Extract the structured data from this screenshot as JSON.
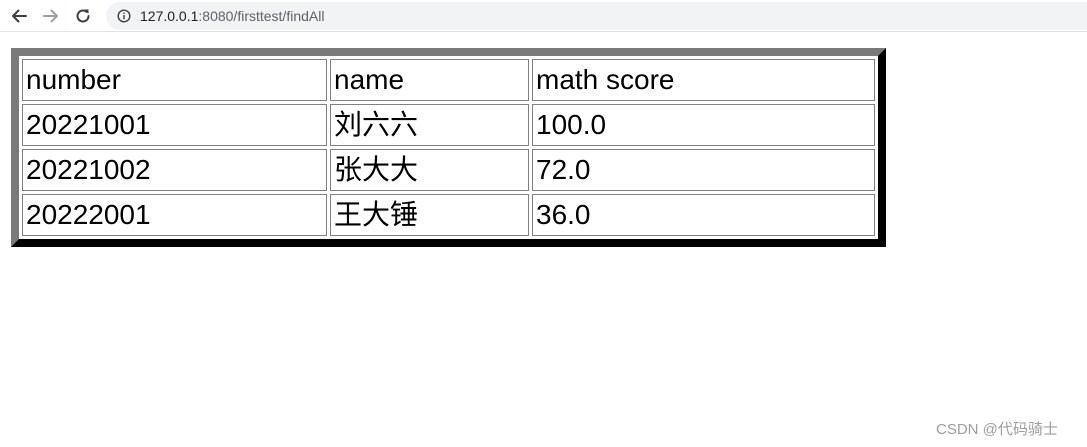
{
  "browser": {
    "url_host": "127.0.0.1",
    "url_rest": ":8080/firsttest/findAll",
    "icons": {
      "back": "arrow-left-icon",
      "forward": "arrow-right-icon",
      "reload": "reload-icon",
      "info": "info-circle-icon"
    }
  },
  "table": {
    "headers": [
      "number",
      "name",
      "math score"
    ],
    "rows": [
      [
        "20221001",
        "刘六六",
        "100.0"
      ],
      [
        "20221002",
        "张大大",
        "72.0"
      ],
      [
        "20222001",
        "王大锤",
        "36.0"
      ]
    ]
  },
  "watermark": {
    "text": "CSDN @代码骑士"
  }
}
